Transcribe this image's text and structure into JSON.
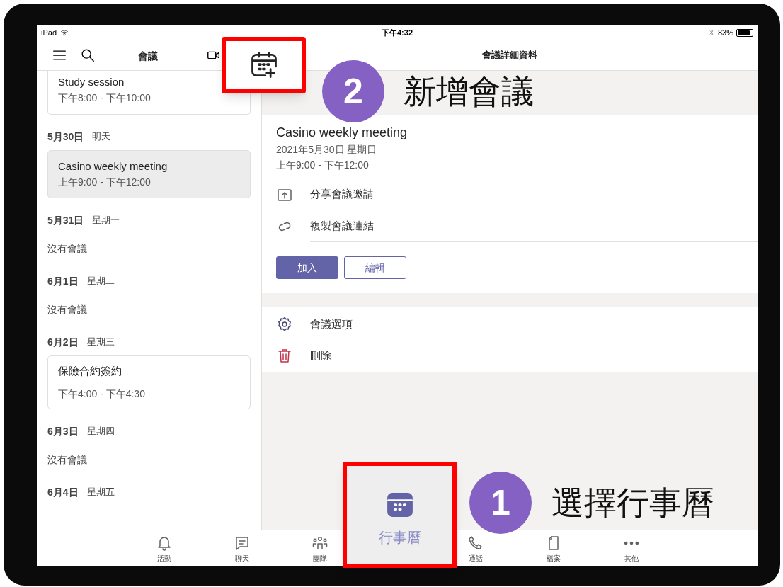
{
  "status_bar": {
    "device": "iPad",
    "time": "下午4:32",
    "battery": "83%"
  },
  "left_header": {
    "title": "會議"
  },
  "agenda": [
    {
      "meetings": [
        {
          "title": "Study session",
          "time": "下午8:00 - 下午10:00",
          "selected": false
        }
      ]
    },
    {
      "date": "5月30日",
      "weekday": "明天",
      "meetings": [
        {
          "title": "Casino weekly meeting",
          "time": "上午9:00 - 下午12:00",
          "selected": true
        }
      ]
    },
    {
      "date": "5月31日",
      "weekday": "星期一",
      "empty_text": "沒有會議"
    },
    {
      "date": "6月1日",
      "weekday": "星期二",
      "empty_text": "沒有會議"
    },
    {
      "date": "6月2日",
      "weekday": "星期三",
      "meetings": [
        {
          "title": "保險合約簽約",
          "time": "下午4:00 - 下午4:30",
          "selected": false
        }
      ]
    },
    {
      "date": "6月3日",
      "weekday": "星期四",
      "empty_text": "沒有會議"
    },
    {
      "date": "6月4日",
      "weekday": "星期五"
    }
  ],
  "detail": {
    "header": "會議詳細資料",
    "title": "Casino weekly meeting",
    "date": "2021年5月30日 星期日",
    "time": "上午9:00 - 下午12:00",
    "actions": [
      {
        "kind": "share",
        "label": "分享會議邀請"
      },
      {
        "kind": "link",
        "label": "複製會議連結"
      }
    ],
    "buttons": [
      {
        "kind": "primary",
        "label": "加入"
      },
      {
        "kind": "outline",
        "label": "編輯"
      }
    ],
    "options": [
      {
        "kind": "settings",
        "label": "會議選項"
      },
      {
        "kind": "delete",
        "label": "刪除"
      }
    ]
  },
  "tab_bar": [
    {
      "kind": "activity",
      "label": "活動",
      "selected": false
    },
    {
      "kind": "chat",
      "label": "聊天",
      "selected": false
    },
    {
      "kind": "teams",
      "label": "團隊",
      "selected": false
    },
    {
      "kind": "calendar",
      "label": "行事曆",
      "selected": true
    },
    {
      "kind": "calls",
      "label": "通話",
      "selected": false
    },
    {
      "kind": "files",
      "label": "檔案",
      "selected": false
    },
    {
      "kind": "more",
      "label": "其他",
      "selected": false
    }
  ],
  "annotations": [
    {
      "kind": "new_meeting",
      "number": "2",
      "text": "新增會議"
    },
    {
      "kind": "calendar_tab",
      "number": "1",
      "text": "選擇行事曆"
    }
  ]
}
